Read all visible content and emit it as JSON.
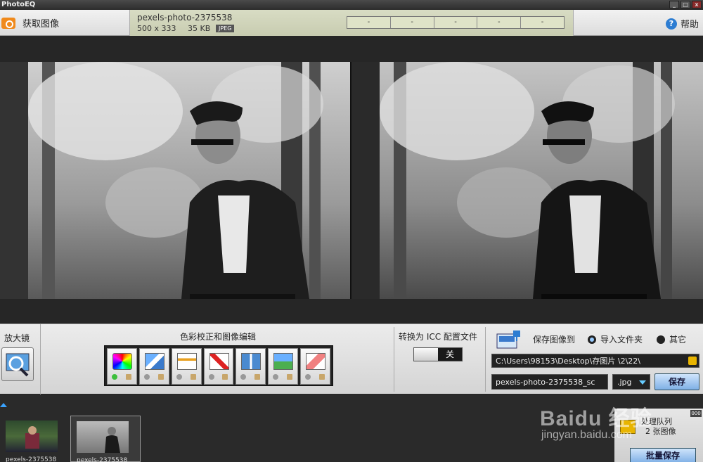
{
  "app": {
    "title": "PhotoEQ"
  },
  "window_buttons": {
    "minimize": "_",
    "maximize": "□",
    "close": "x"
  },
  "toolbar": {
    "acquire_label": "获取图像",
    "help_label": "帮助",
    "help_icon": "?"
  },
  "file": {
    "name": "pexels-photo-2375538",
    "dimensions": "500 x 333",
    "size": "35 KB",
    "type": "JPEG"
  },
  "meters": [
    "-",
    "-",
    "-",
    "-",
    "-"
  ],
  "panel": {
    "magnifier_label": "放大镜",
    "correction_title": "色彩校正和图像编辑",
    "tools": [
      {
        "icon": "color-wheel-icon",
        "active": true
      },
      {
        "icon": "rotate-icon",
        "active": false
      },
      {
        "icon": "crop-icon",
        "active": false
      },
      {
        "icon": "red-eye-icon",
        "active": false
      },
      {
        "icon": "frame-icon",
        "active": false
      },
      {
        "icon": "effects-icon",
        "active": false
      },
      {
        "icon": "eraser-icon",
        "active": false
      }
    ],
    "icc_label": "转换为 ICC 配置文件",
    "icc_state": "关",
    "save_to_label": "保存图像到",
    "radio_import": "导入文件夹",
    "radio_other": "其它",
    "path": "C:\\Users\\98153\\Desktop\\存图片 \\2\\22\\",
    "output_name": "pexels-photo-2375538_sc",
    "extension": ".jpg",
    "save_label": "保存"
  },
  "filmstrip": {
    "items": [
      {
        "caption": "pexels-2375538"
      },
      {
        "caption": "pexels-2375538"
      }
    ]
  },
  "batch": {
    "queue_label": "处理队列",
    "queue_count": "2 张图像",
    "batch_save_label": "批量保存",
    "menu": "000"
  },
  "watermark": {
    "line1": "Baidu 经验",
    "line2": "jingyan.baidu.com"
  },
  "colors": {
    "accent": "#3aa3ff",
    "file_panel": "#d3d7bb"
  }
}
